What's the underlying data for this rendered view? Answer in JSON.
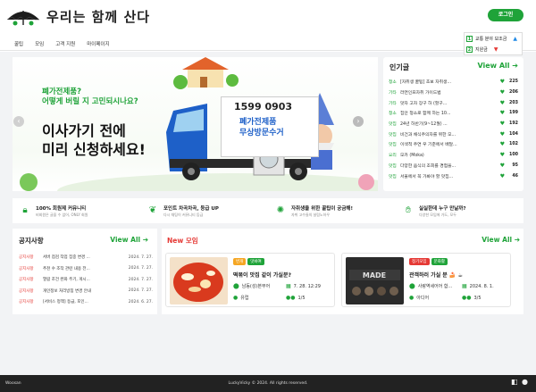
{
  "app": {
    "title": "우리는 함께 산다",
    "login_label": "로그인"
  },
  "nav": [
    "꿀팁",
    "모임",
    "고객 지원",
    "마이페이지"
  ],
  "ranking": [
    {
      "rank": "1",
      "label": "교통 분야 보조금",
      "trend": "up"
    },
    {
      "rank": "2",
      "label": "지원금",
      "trend": "down"
    }
  ],
  "hero": {
    "sub1": "폐가전제품?",
    "sub2": "어떻게 버릴 지 고민되시나요?",
    "main1": "이사가기 전에",
    "main2": "미리 신청하세요!",
    "truck_phone": "1599 0903",
    "truck_text1": "폐가전제품",
    "truck_text2": "무상방문수거"
  },
  "popular": {
    "title": "인기글",
    "view_all": "View All ➔",
    "items": [
      {
        "cat": "청소",
        "text": "[자취생 꿀팁] 초보 자취생...",
        "count": "225"
      },
      {
        "cat": "기타",
        "text": "라면인프자취 가이드법",
        "count": "206"
      },
      {
        "cat": "기타",
        "text": "맛자 고자 장구 하 (할구...",
        "count": "203"
      },
      {
        "cat": "청소",
        "text": "집안 청소로 함께 하는 10...",
        "count": "199"
      },
      {
        "cat": "맛집",
        "text": "24년 하반기(9~12월) ...",
        "count": "192"
      },
      {
        "cat": "맛집",
        "text": "비건과 채식주의자를 위한 모...",
        "count": "104"
      },
      {
        "cat": "맛집",
        "text": "이색적 주연 우 기준에서 배달...",
        "count": "102"
      },
      {
        "cat": "요리",
        "text": "모카 (Moka)",
        "count": "100"
      },
      {
        "cat": "맛집",
        "text": "다양한 음식의 조회를 경험을...",
        "count": "95"
      },
      {
        "cat": "맛집",
        "text": "서울에서 꼭 가봐야 할 맛집...",
        "count": "46"
      }
    ]
  },
  "features": [
    {
      "icon": "lock-icon",
      "title": "100% 회원제 커뮤니티",
      "desc": "비회원은 글을 수 없어, ONLY 회원"
    },
    {
      "icon": "leaf-icon",
      "title": "포인트 차곡차곡, 등급 UP",
      "desc": "다시 채팅이 커뮤니티 등급"
    },
    {
      "icon": "lightbulb-icon",
      "title": "자취생을 위한 꿀팁이 궁금해!",
      "desc": "자취 고수들의 살림노하우"
    },
    {
      "icon": "handshake-icon",
      "title": "실실한데 누구 만날까?",
      "desc": "다양한 모임에 가도, 모두"
    }
  ],
  "notice": {
    "title": "공지사항",
    "view_all": "View All ➔",
    "items": [
      {
        "tag": "공지사항",
        "text": "서버 점검 작업 집중 변경 ...",
        "date": "2024. 7. 27."
      },
      {
        "tag": "공지사항",
        "text": "추천 수 조작 관련 내용 전...",
        "date": "2024. 7. 27."
      },
      {
        "tag": "공지사항",
        "text": "열람 조건 완화 주기, 게시...",
        "date": "2024. 7. 27."
      },
      {
        "tag": "공지사항",
        "text": "개인정보 처리방침 변경 안내",
        "date": "2024. 7. 27."
      },
      {
        "tag": "공지사항",
        "text": "[서비스 정책] 등급, 포인...",
        "date": "2024. 6. 27."
      }
    ]
  },
  "meetings": {
    "title": "New 모임",
    "view_all": "View All ➔",
    "cards": [
      {
        "tags": [
          {
            "label": "번개",
            "color": "#f5a623"
          },
          {
            "label": "맛봐여",
            "color": "#1fa339"
          }
        ],
        "title": "떡볶이 맛집 같이 가실분?",
        "location": "남동(성)본부어",
        "date": "7. 28. 12:29",
        "host": "유럽",
        "members": "1/5"
      },
      {
        "tags": [
          {
            "label": "정기모임",
            "color": "#e53935"
          },
          {
            "label": "문화활",
            "color": "#1fa339"
          }
        ],
        "title": "관객하러 가실 분 🍰 ☕",
        "location": "사랑역세어어 합...",
        "date": "2024. 8. 1.",
        "host": "아디어",
        "members": "3/5"
      }
    ]
  },
  "footer": {
    "left": "Woosan",
    "center": "LuckyVicky © 2024. All rights reserved.",
    "icons": [
      "figma-icon",
      "github-icon"
    ]
  },
  "colors": {
    "brand": "#1fa339",
    "accent_red": "#e53935"
  }
}
